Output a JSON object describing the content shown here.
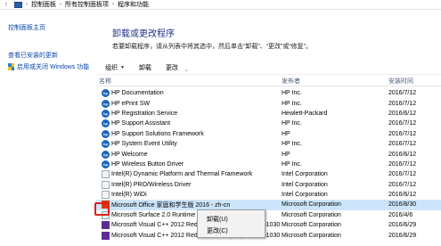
{
  "address_bar": {
    "crumbs": [
      "控制面板",
      "所有控制面板项",
      "程序和功能"
    ]
  },
  "left_pane": {
    "home_link": "控制面板主页",
    "view_updates_link": "查看已安装的更新",
    "windows_features_link": "启用或关闭 Windows 功能"
  },
  "main": {
    "title": "卸载或更改程序",
    "description": "若要卸载程序，请从列表中将其选中，然后单击“卸载”、“更改”或“修复”。"
  },
  "toolbar": {
    "organize_label": "组织",
    "uninstall_label": "卸载",
    "change_label": "更改"
  },
  "columns": {
    "name": "名称",
    "publisher": "发布者",
    "installed_on": "安装时间"
  },
  "programs": [
    {
      "name": "HP Documentation",
      "publisher": "HP Inc.",
      "date": "2016/7/12",
      "icon": "hp-icon"
    },
    {
      "name": "HP ePrint SW",
      "publisher": "HP Inc.",
      "date": "2016/7/12",
      "icon": "hp-icon"
    },
    {
      "name": "HP Registration Service",
      "publisher": "Hewlett-Packard",
      "date": "2016/6/12",
      "icon": "hp-icon"
    },
    {
      "name": "HP Support Assistant",
      "publisher": "HP Inc.",
      "date": "2016/7/12",
      "icon": "hp-icon"
    },
    {
      "name": "HP Support Solutions Framework",
      "publisher": "HP",
      "date": "2016/7/12",
      "icon": "hp-icon"
    },
    {
      "name": "HP System Event Utility",
      "publisher": "HP Inc.",
      "date": "2016/7/12",
      "icon": "hp-icon"
    },
    {
      "name": "HP Welcome",
      "publisher": "HP",
      "date": "2016/6/12",
      "icon": "hp-icon"
    },
    {
      "name": "HP Wireless Button Driver",
      "publisher": "HP Inc.",
      "date": "2016/7/12",
      "icon": "hp-icon"
    },
    {
      "name": "Intel(R) Dynamic Platform and Thermal Framework",
      "publisher": "Intel Corporation",
      "date": "2016/7/12",
      "icon": "intel-icon"
    },
    {
      "name": "Intel(R) PRO/Wireless Driver",
      "publisher": "Intel Corporation",
      "date": "2016/7/12",
      "icon": "intel-icon"
    },
    {
      "name": "Intel(R) WiDi",
      "publisher": "Intel Corporation",
      "date": "2016/6/12",
      "icon": "intel-icon"
    },
    {
      "name": "Microsoft Office 家庭和学生版 2016 - zh-cn",
      "publisher": "Microsoft Corporation",
      "date": "2016/8/30",
      "icon": "office-icon",
      "selected": true
    },
    {
      "name": "Microsoft Surface 2.0 Runtime",
      "publisher": "Microsoft Corporation",
      "date": "2016/4/6",
      "icon": "ms-icon"
    },
    {
      "name": "Microsoft Visual C++ 2012 Redistributable (x64) - 11.0.61030",
      "publisher": "Microsoft Corporation",
      "date": "2016/6/29",
      "icon": "vc-icon"
    },
    {
      "name": "Microsoft Visual C++ 2012 Redistributable (x86) - 11.0.61030",
      "publisher": "Microsoft Corporation",
      "date": "2016/6/29",
      "icon": "vc-icon"
    }
  ],
  "context_menu": {
    "uninstall": "卸载(U)",
    "change": "更改(C)"
  },
  "colors": {
    "link": "#0b47a8",
    "title": "#1e3287",
    "selection": "#cce5fb",
    "highlight_box": "#e01e1e"
  }
}
